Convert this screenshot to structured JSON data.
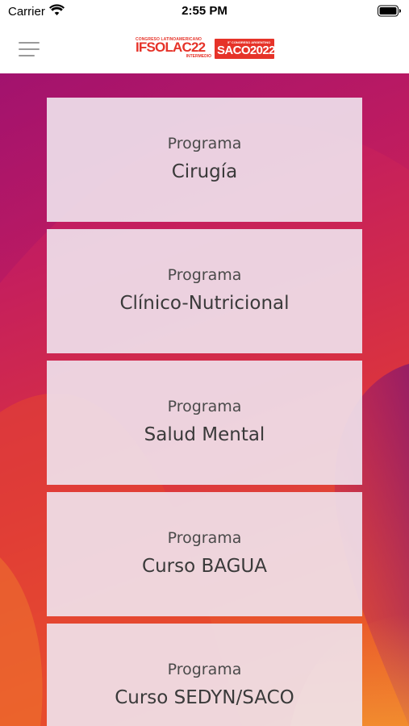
{
  "status_bar": {
    "carrier": "Carrier",
    "time": "2:55 PM",
    "wifi_icon": "wifi-icon",
    "battery_icon": "battery-icon"
  },
  "header": {
    "menu_icon": "hamburger-menu-icon",
    "logo": {
      "ifso_top": "CONGRESO LATINOAMERICANO",
      "ifso_brand": "IFSOLAC22",
      "ifso_sub": "INTERMEDIO",
      "saco_top": "5° CONGRESO ARGENTINO",
      "saco_brand": "SACO2022",
      "brand_color": "#e63329"
    }
  },
  "programs": [
    {
      "label": "Programa",
      "title": "Cirugía"
    },
    {
      "label": "Programa",
      "title": "Clínico-Nutricional"
    },
    {
      "label": "Programa",
      "title": "Salud Mental"
    },
    {
      "label": "Programa",
      "title": "Curso BAGUA"
    },
    {
      "label": "Programa",
      "title": "Curso SEDYN/SACO"
    }
  ],
  "colors": {
    "background_start": "#b2166d",
    "background_end": "#ee6a22",
    "card_background": "#f0e4ee",
    "text": "#3a3a3a"
  }
}
